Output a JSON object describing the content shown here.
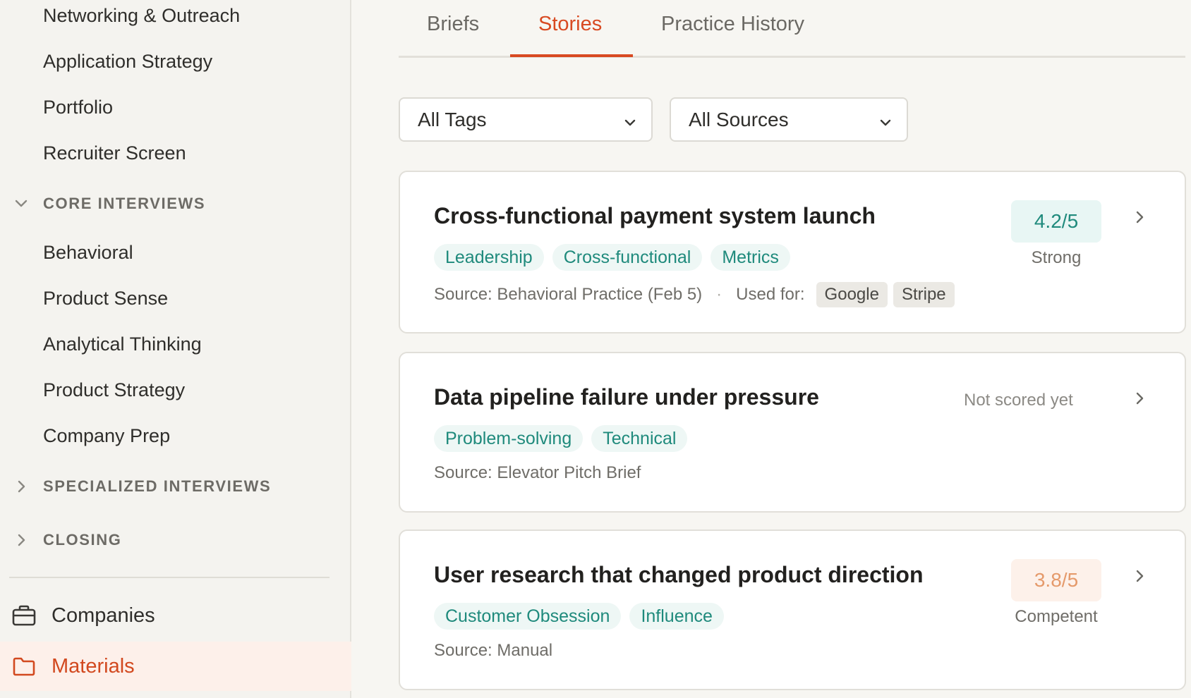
{
  "sidebar": {
    "top_items": [
      {
        "label": "Networking & Outreach"
      },
      {
        "label": "Application Strategy"
      },
      {
        "label": "Portfolio"
      },
      {
        "label": "Recruiter Screen"
      }
    ],
    "core_header": "CORE INTERVIEWS",
    "core_items": [
      {
        "label": "Behavioral"
      },
      {
        "label": "Product Sense"
      },
      {
        "label": "Analytical Thinking"
      },
      {
        "label": "Product Strategy"
      },
      {
        "label": "Company Prep"
      }
    ],
    "specialized_header": "SPECIALIZED INTERVIEWS",
    "closing_header": "CLOSING",
    "companies_label": "Companies",
    "materials_label": "Materials"
  },
  "tabs": [
    {
      "label": "Briefs"
    },
    {
      "label": "Stories"
    },
    {
      "label": "Practice History"
    }
  ],
  "filters": {
    "tags_selected": "All Tags",
    "sources_selected": "All Sources"
  },
  "stories": [
    {
      "title": "Cross-functional payment system launch",
      "tags": [
        "Leadership",
        "Cross-functional",
        "Metrics"
      ],
      "source": "Source: Behavioral Practice (Feb 5)",
      "separator": "·",
      "used_for_label": "Used for:",
      "used_for": [
        "Google",
        "Stripe"
      ],
      "score": "4.2/5",
      "score_label": "Strong"
    },
    {
      "title": "Data pipeline failure under pressure",
      "tags": [
        "Problem-solving",
        "Technical"
      ],
      "source": "Source: Elevator Pitch Brief",
      "not_scored": "Not scored yet"
    },
    {
      "title": "User research that changed product direction",
      "tags": [
        "Customer Obsession",
        "Influence"
      ],
      "source": "Source: Manual",
      "score": "3.8/5",
      "score_label": "Competent"
    }
  ],
  "colors": {
    "accent": "#d84a22",
    "teal": "#1f8a7c",
    "competent": "#e59a6b"
  }
}
